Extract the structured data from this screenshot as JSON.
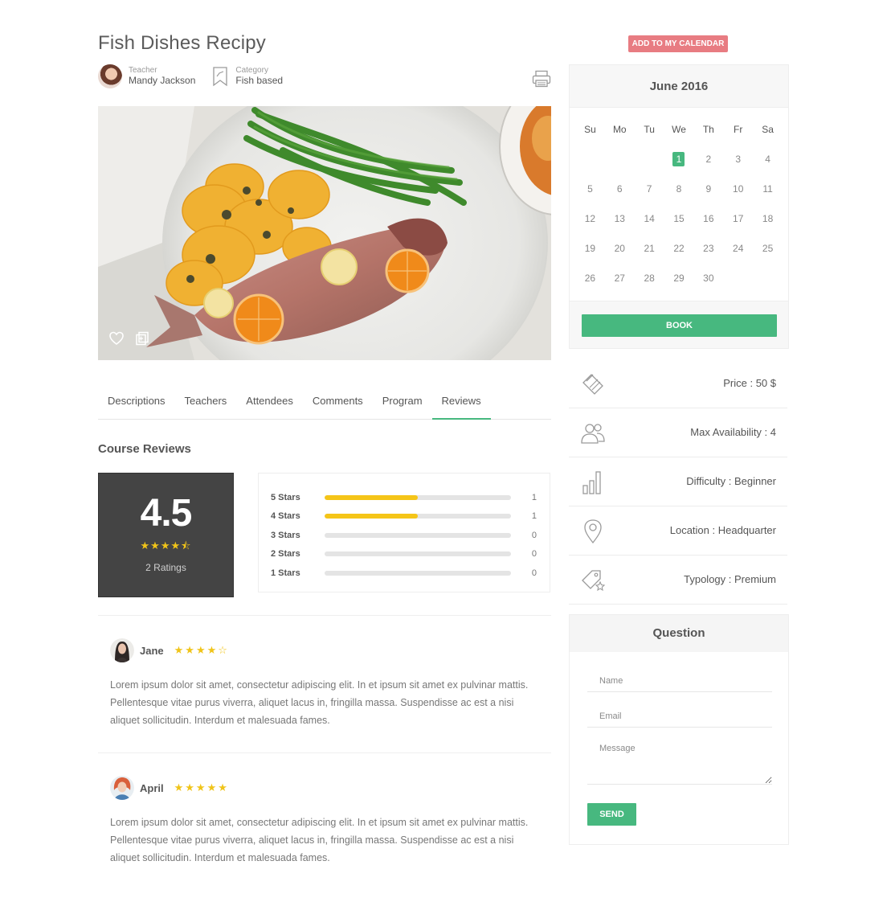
{
  "page": {
    "title": "Fish Dishes Recipy"
  },
  "meta": {
    "teacher_label": "Teacher",
    "teacher_name": "Mandy Jackson",
    "category_label": "Category",
    "category_name": "Fish based"
  },
  "tabs": [
    {
      "label": "Descriptions"
    },
    {
      "label": "Teachers"
    },
    {
      "label": "Attendees"
    },
    {
      "label": "Comments"
    },
    {
      "label": "Program"
    },
    {
      "label": "Reviews",
      "active": true
    }
  ],
  "reviews_section": {
    "title": "Course Reviews",
    "average": "4.5",
    "average_stars": "★★★★⯪",
    "ratings_count": "2 Ratings",
    "breakdown": [
      {
        "label": "5 Stars",
        "fill": 0.5,
        "count": "1"
      },
      {
        "label": "4 Stars",
        "fill": 0.5,
        "count": "1"
      },
      {
        "label": "3 Stars",
        "fill": 0,
        "count": "0"
      },
      {
        "label": "2 Stars",
        "fill": 0,
        "count": "0"
      },
      {
        "label": "1 Stars",
        "fill": 0,
        "count": "0"
      }
    ]
  },
  "reviews": [
    {
      "name": "Jane",
      "stars": "★★★★☆",
      "text": "Lorem ipsum dolor sit amet, consectetur adipiscing elit. In et ipsum sit amet ex pulvinar mattis. Pellentesque vitae purus viverra, aliquet lacus in, fringilla massa. Suspendisse ac est a nisi aliquet sollicitudin. Interdum et malesuada fames."
    },
    {
      "name": "April",
      "stars": "★★★★★",
      "text": "Lorem ipsum dolor sit amet, consectetur adipiscing elit. In et ipsum sit amet ex pulvinar mattis. Pellentesque vitae purus viverra, aliquet lacus in, fringilla massa. Suspendisse ac est a nisi aliquet sollicitudin. Interdum et malesuada fames."
    }
  ],
  "calendar": {
    "add_button": "ADD TO MY CALENDAR",
    "month": "June 2016",
    "weekdays": [
      "Su",
      "Mo",
      "Tu",
      "We",
      "Th",
      "Fr",
      "Sa"
    ],
    "leading_blanks": 3,
    "days_in_month": 30,
    "selected_day": 1,
    "book_button": "BOOK"
  },
  "info": [
    {
      "icon": "price-tag-icon",
      "text": "Price : 50 $"
    },
    {
      "icon": "users-icon",
      "text": "Max Availability : 4"
    },
    {
      "icon": "bar-chart-icon",
      "text": "Difficulty : Beginner"
    },
    {
      "icon": "map-pin-icon",
      "text": "Location : Headquarter"
    },
    {
      "icon": "tag-star-icon",
      "text": "Typology : Premium"
    }
  ],
  "question": {
    "title": "Question",
    "name_placeholder": "Name",
    "email_placeholder": "Email",
    "message_placeholder": "Message",
    "send_button": "SEND"
  },
  "colors": {
    "accent": "#47b87f",
    "calendar_button": "#e87c82",
    "star": "#f0c419",
    "bar_fill": "#f5c518",
    "score_bg": "#444444"
  }
}
